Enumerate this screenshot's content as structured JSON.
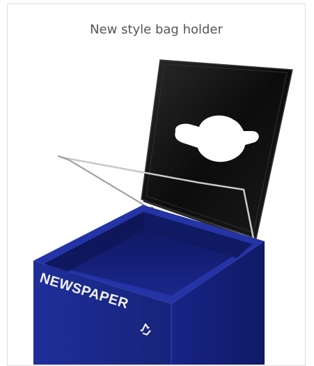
{
  "caption": "New style bag holder",
  "product": {
    "label_text": "NEWSPAPER",
    "recycle_symbol": "recycle-icon",
    "colors": {
      "bin_blue": "#1d2a8c",
      "lid_black": "#111111",
      "wire_steel": "#b8b8b8"
    }
  }
}
